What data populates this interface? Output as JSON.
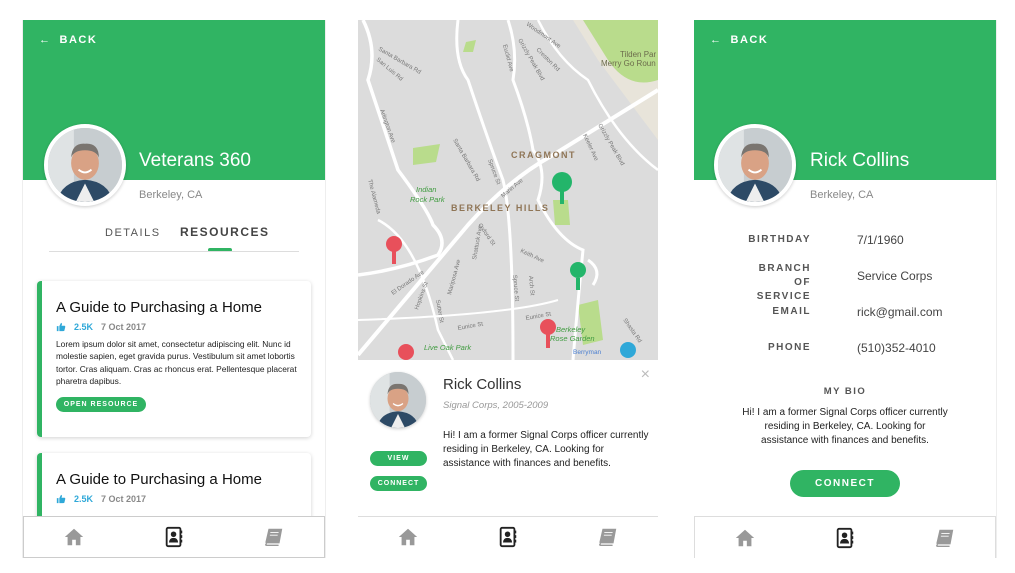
{
  "colors": {
    "brand": "#30b463",
    "likes": "#2fa8d8",
    "pin_red": "#e8505b",
    "pin_green": "#23b56a",
    "pin_blue": "#2fa8d8"
  },
  "back_label": "BACK",
  "screen1": {
    "name": "Veterans 360",
    "location": "Berkeley, CA",
    "tabs": [
      {
        "label": "DETAILS",
        "active": false
      },
      {
        "label": "RESOURCES",
        "active": true
      }
    ],
    "cards": [
      {
        "title": "A Guide to Purchasing a Home",
        "likes": "2.5K",
        "date": "7 Oct 2017",
        "body": "Lorem ipsum dolor sit amet, consectetur adipiscing elit. Nunc id molestie sapien, eget gravida purus. Vestibulum sit amet lobortis tortor. Cras aliquam. Cras ac rhoncus erat. Pellentesque placerat pharetra dapibus.",
        "button": "OPEN RESOURCE"
      },
      {
        "title": "A Guide to Purchasing a Home",
        "likes": "2.5K",
        "date": "7 Oct 2017"
      }
    ]
  },
  "map": {
    "labels": {
      "cragmont": "CRAGMONT",
      "hills": "BERKELEY HILLS",
      "indian": "Indian",
      "indian2": "Rock Park",
      "tilden": "Tilden Par",
      "tilden2": "Merry Go Roun",
      "liveoak": "Live Oak Park",
      "rose": "Berkeley",
      "rose2": "Rose Garden",
      "berryman": "Berryman",
      "marin": "Marin Ave",
      "spruce": "Spruce St",
      "euclid": "Euclid Ave",
      "eunice": "Eunice St",
      "alameda": "The Alameda",
      "keith": "Keith Ave",
      "arch": "Arch St",
      "oxford": "Oxford St",
      "grizzly": "Grizzly Peak Blvd",
      "santabarbara": "Santa Barbara Rd",
      "sanluis": "San Luis Rd",
      "arlington": "Arlington Ave",
      "eldorado": "El Dorado Ave",
      "hopkins": "Hopkins St",
      "sutter": "Sutter St",
      "mariposa": "Mariposa Ave",
      "shattuck": "Shattuck Ave",
      "shasta": "Shasta Rd",
      "keeler": "Keeler Ave",
      "woodmont": "Woodmont Ave",
      "crestonrd": "Creston Rd"
    }
  },
  "popup": {
    "name": "Rick Collins",
    "subtitle": "Signal Corps, 2005-2009",
    "bio": "Hi! I am a former Signal Corps officer currently residing in Berkeley, CA. Looking for assistance with finances and benefits.",
    "view": "VIEW",
    "connect": "CONNECT",
    "close": "×"
  },
  "screen3": {
    "name": "Rick Collins",
    "location": "Berkeley, CA",
    "fields": [
      {
        "label": "BIRTHDAY",
        "value": "7/1/1960"
      },
      {
        "label": "BRANCH OF SERVICE",
        "value": "Service Corps"
      },
      {
        "label": "EMAIL",
        "value": "rick@gmail.com"
      },
      {
        "label": "PHONE",
        "value": "(510)352-4010"
      }
    ],
    "bio_label": "MY BIO",
    "bio": "Hi! I am a former Signal Corps officer currently residing in Berkeley, CA. Looking for assistance with finances and benefits.",
    "connect": "CONNECT"
  },
  "nav": [
    {
      "icon": "home-icon",
      "active": false
    },
    {
      "icon": "contacts-icon",
      "active": true
    },
    {
      "icon": "book-icon",
      "active": false
    }
  ]
}
